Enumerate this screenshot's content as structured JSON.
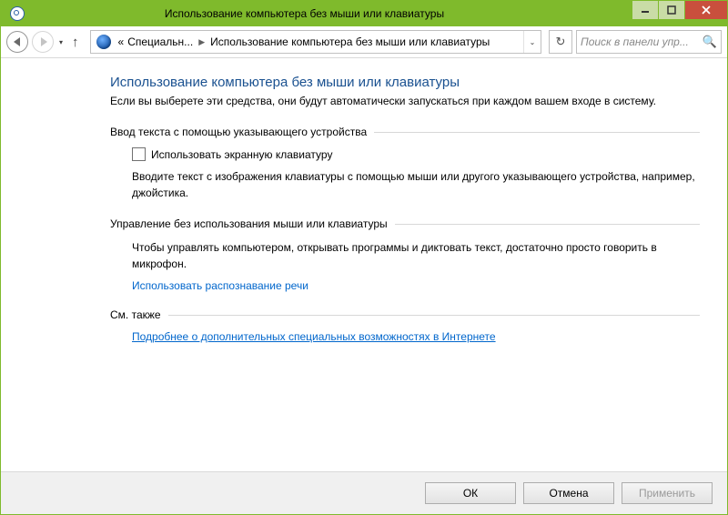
{
  "title": "Использование компьютера без мыши или клавиатуры",
  "breadcrumb": {
    "prefix": "«",
    "seg1": "Специальн...",
    "seg2": "Использование компьютера без мыши или клавиатуры"
  },
  "search_placeholder": "Поиск в панели упр...",
  "page": {
    "heading": "Использование компьютера без мыши или клавиатуры",
    "desc": "Если вы выберете эти средства, они будут автоматически запускаться при каждом вашем входе в систему."
  },
  "group1": {
    "heading": "Ввод текста с помощью указывающего устройства",
    "checkbox_label": "Использовать экранную клавиатуру",
    "help": "Вводите текст с изображения клавиатуры с помощью мыши или другого указывающего устройства, например, джойстика."
  },
  "group2": {
    "heading": "Управление без использования мыши или клавиатуры",
    "help": "Чтобы управлять компьютером, открывать программы и диктовать текст, достаточно просто говорить в микрофон.",
    "link": "Использовать распознавание речи"
  },
  "see_also": {
    "heading": "См. также",
    "link": "Подробнее о дополнительных специальных возможностях в Интернете"
  },
  "buttons": {
    "ok": "ОК",
    "cancel": "Отмена",
    "apply": "Применить"
  }
}
